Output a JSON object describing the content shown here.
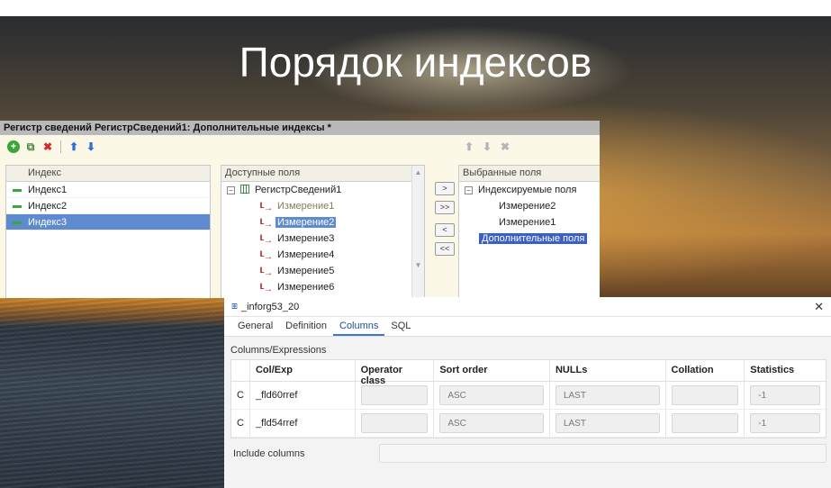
{
  "slide": {
    "title": "Порядок индексов"
  },
  "onec": {
    "window_title": "Регистр сведений РегистрСведений1: Дополнительные индексы *",
    "toolbar_icons": [
      "add-icon",
      "copy-icon",
      "delete-icon",
      "move-up-icon",
      "move-down-icon"
    ],
    "indexes": {
      "header": "Индекс",
      "items": [
        {
          "label": "Индекс1",
          "selected": false
        },
        {
          "label": "Индекс2",
          "selected": false
        },
        {
          "label": "Индекс3",
          "selected": true
        }
      ]
    },
    "available": {
      "header": "Доступные поля",
      "root": "РегистрСведений1",
      "items": [
        {
          "label": "Измерение1",
          "state": "muted"
        },
        {
          "label": "Измерение2",
          "state": "highlighted"
        },
        {
          "label": "Измерение3",
          "state": "normal"
        },
        {
          "label": "Измерение4",
          "state": "normal"
        },
        {
          "label": "Измерение5",
          "state": "normal"
        },
        {
          "label": "Измерение6",
          "state": "normal"
        }
      ]
    },
    "move_buttons": [
      ">",
      ">>",
      "<",
      "<<"
    ],
    "selected": {
      "header": "Выбранные поля",
      "group": "Индексируемые поля",
      "items": [
        "Измерение2",
        "Измерение1"
      ],
      "extra": "Дополнительные поля"
    }
  },
  "dbeaver": {
    "title": "_inforg53_20",
    "tabs": [
      "General",
      "Definition",
      "Columns",
      "SQL"
    ],
    "active_tab": "Columns",
    "group_label": "Columns/Expressions",
    "columns": [
      "",
      "Col/Exp",
      "Operator class",
      "Sort order",
      "NULLs",
      "Collation",
      "Statistics"
    ],
    "rows": [
      {
        "type": "C",
        "col": "_fld60rref",
        "opclass": "",
        "sort": "ASC",
        "nulls": "LAST",
        "collation": "",
        "stats": "-1"
      },
      {
        "type": "C",
        "col": "_fld54rref",
        "opclass": "",
        "sort": "ASC",
        "nulls": "LAST",
        "collation": "",
        "stats": "-1"
      }
    ],
    "include_label": "Include columns"
  }
}
